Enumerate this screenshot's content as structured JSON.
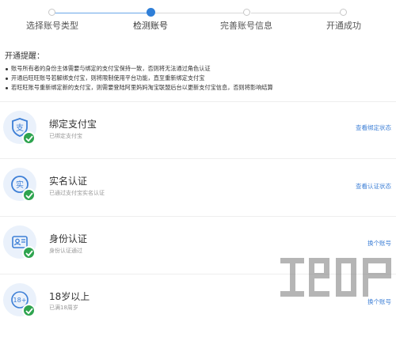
{
  "stepper": {
    "steps": [
      {
        "label": "选择账号类型",
        "state": "done"
      },
      {
        "label": "检测账号",
        "state": "active"
      },
      {
        "label": "完善账号信息",
        "state": "todo"
      },
      {
        "label": "开通成功",
        "state": "todo"
      }
    ]
  },
  "notice": {
    "title": "开通提醒：",
    "items": [
      "账号所有者的身份主体需要与绑定的支付宝保持一致，否则将无法通过角色认证",
      "开通后旺旺账号若解绑支付宝，则将限制使用平台功能，直至重新绑定支付宝",
      "若旺旺账号重新绑定新的支付宝，则需要登陆阿里妈妈淘宝联盟后台以更新支付宝信息，否则将影响结算"
    ]
  },
  "cards": [
    {
      "icon": "alipay-icon",
      "title": "绑定支付宝",
      "sub": "已绑定支付宝",
      "link": "查看绑定状态"
    },
    {
      "icon": "id-real-name-icon",
      "title": "实名认证",
      "sub": "已通过支付宝实名认证",
      "link": "查看认证状态"
    },
    {
      "icon": "id-card-icon",
      "title": "身份认证",
      "sub": "身份认证通过",
      "link": "换个账号"
    },
    {
      "icon": "age-18-icon",
      "title": "18岁以上",
      "sub": "已满18周岁",
      "link": "换个账号"
    }
  ],
  "status": {
    "check_icon": "check-icon",
    "check_color": "#2ea44f"
  },
  "colors": {
    "accent": "#2f7fd8",
    "link": "#3d7fd6",
    "icon_bg": "#eaf1fb"
  }
}
